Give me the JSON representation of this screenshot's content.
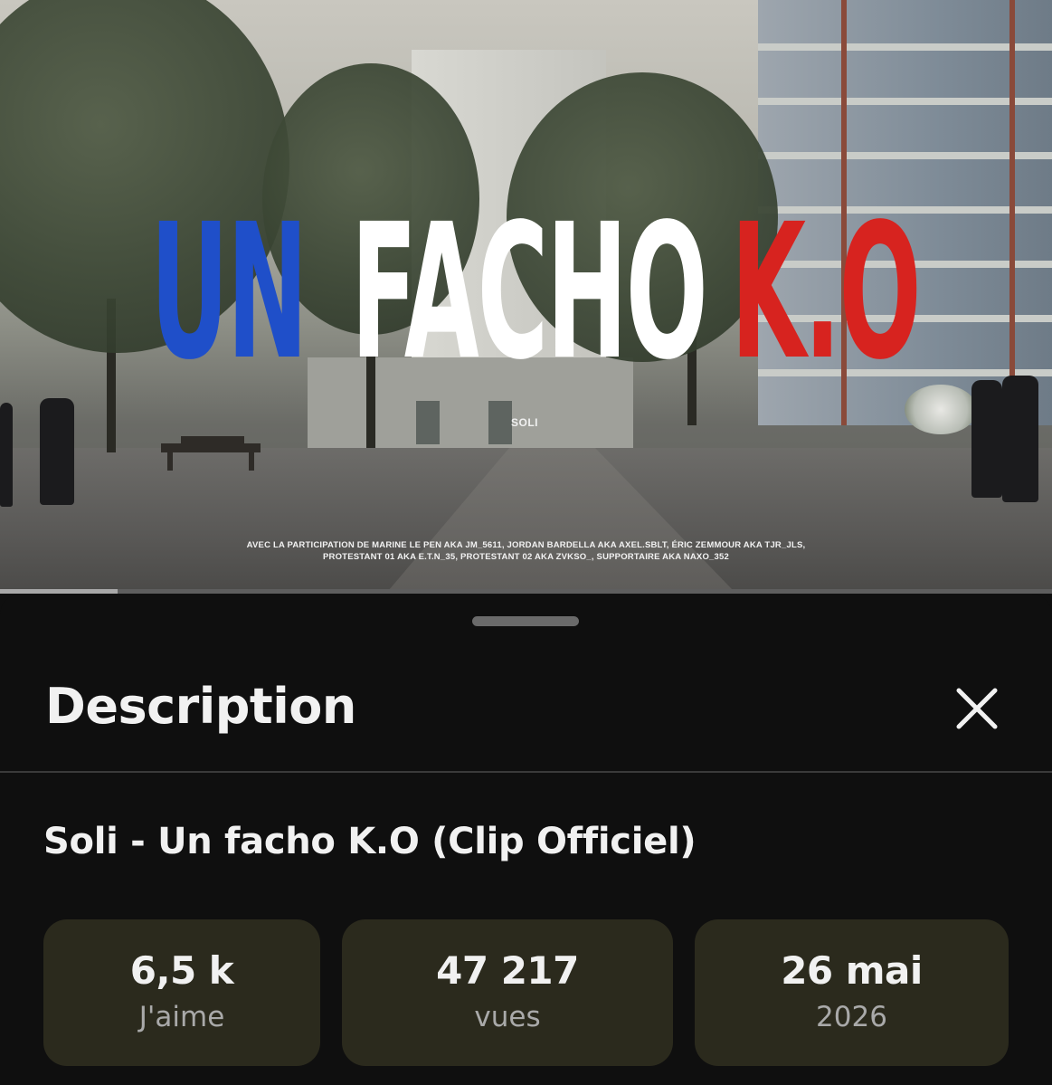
{
  "video": {
    "overlay_title": {
      "word1": "UN",
      "word2": "FACHO",
      "word3": "K.O"
    },
    "artist_tag": "SOLI",
    "credits_line1": "AVEC LA PARTICIPATION DE MARINE LE PEN AKA JM_5611, JORDAN BARDELLA AKA AXEL.SBLT, ÉRIC ZEMMOUR AKA TJR_JLS,",
    "credits_line2": "PROTESTANT 01 AKA E.T.N_35, PROTESTANT 02 AKA ZVKSO_, SUPPORTAIRE AKA NAXO_352",
    "progress_fraction": 0.112,
    "colors": {
      "blue": "#1f4fc9",
      "white": "#ffffff",
      "red": "#d7231f"
    }
  },
  "sheet": {
    "title": "Description",
    "close_icon": "close-icon",
    "video_title": "Soli - Un facho K.O (Clip Officiel)",
    "stats": [
      {
        "value": "6,5 k",
        "label": "J'aime"
      },
      {
        "value": "47 217",
        "label": "vues"
      },
      {
        "value": "26 mai",
        "label": "2026"
      }
    ],
    "stat_card_color": "#2b2a1d"
  }
}
